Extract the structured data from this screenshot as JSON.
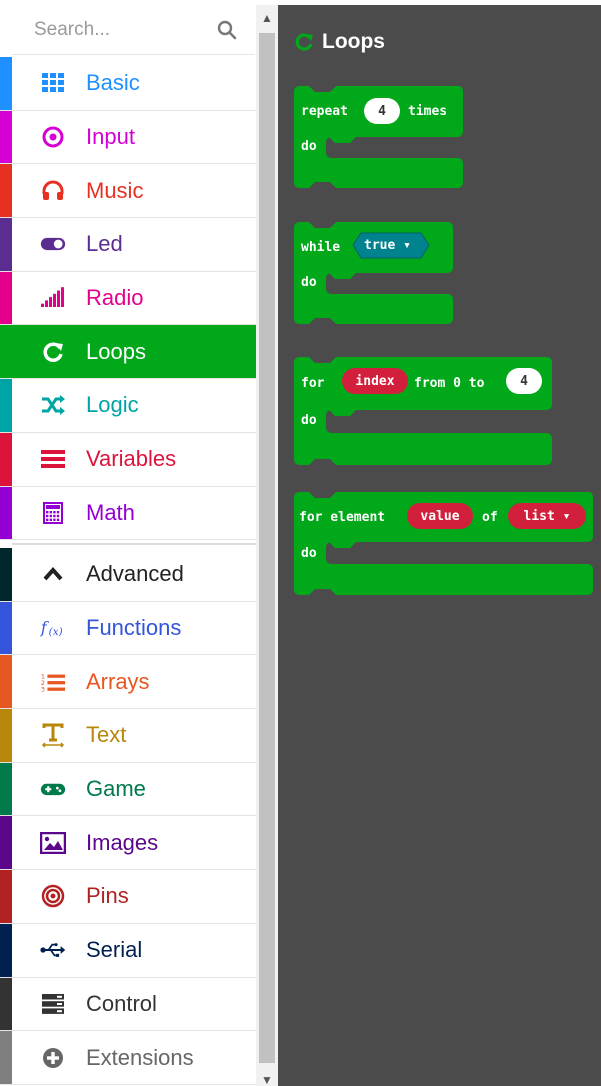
{
  "search": {
    "placeholder": "Search..."
  },
  "categories": [
    {
      "label": "Basic",
      "color": "#1e90ff",
      "icon": "grid-icon"
    },
    {
      "label": "Input",
      "color": "#d400d4",
      "icon": "target-icon"
    },
    {
      "label": "Music",
      "color": "#e63022",
      "icon": "headphones-icon"
    },
    {
      "label": "Led",
      "color": "#5c2d91",
      "icon": "toggle-icon"
    },
    {
      "label": "Radio",
      "color": "#e3008c",
      "icon": "signal-bars-icon"
    },
    {
      "label": "Loops",
      "color": "#00a81a",
      "icon": "loop-arrow-icon",
      "selected": true
    },
    {
      "label": "Logic",
      "color": "#00a4a6",
      "icon": "shuffle-icon"
    },
    {
      "label": "Variables",
      "color": "#dc143c",
      "icon": "lines-icon"
    },
    {
      "label": "Math",
      "color": "#9400d3",
      "icon": "calculator-icon"
    }
  ],
  "advanced": [
    {
      "label": "Advanced",
      "color": "#00272b",
      "text_color": "#222222",
      "icon": "chevron-up-icon"
    },
    {
      "label": "Functions",
      "color": "#3455db",
      "icon": "function-icon"
    },
    {
      "label": "Arrays",
      "color": "#e65722",
      "icon": "numbered-list-icon"
    },
    {
      "label": "Text",
      "color": "#b8860b",
      "icon": "text-icon"
    },
    {
      "label": "Game",
      "color": "#007a4b",
      "icon": "gamepad-icon"
    },
    {
      "label": "Images",
      "color": "#5c068c",
      "icon": "image-icon"
    },
    {
      "label": "Pins",
      "color": "#b22222",
      "icon": "pin-icon"
    },
    {
      "label": "Serial",
      "color": "#002050",
      "icon": "usb-icon"
    },
    {
      "label": "Control",
      "color": "#333333",
      "icon": "server-icon"
    },
    {
      "label": "Extensions",
      "color": "#7f7f7f",
      "text_color": "#666666",
      "icon": "plus-circle-icon"
    }
  ],
  "flyout": {
    "title": "Loops",
    "accent": "#00a81a",
    "repeat": {
      "kw1": "repeat",
      "count": "4",
      "kw2": "times",
      "do": "do"
    },
    "while": {
      "kw": "while",
      "cond": "true ▾",
      "do": "do"
    },
    "for_range": {
      "kw1": "for",
      "var": "index",
      "kw2": "from 0 to",
      "to": "4",
      "do": "do"
    },
    "for_each": {
      "kw1": "for element",
      "var": "value",
      "kw2": "of",
      "list": "list ▾",
      "do": "do"
    }
  }
}
